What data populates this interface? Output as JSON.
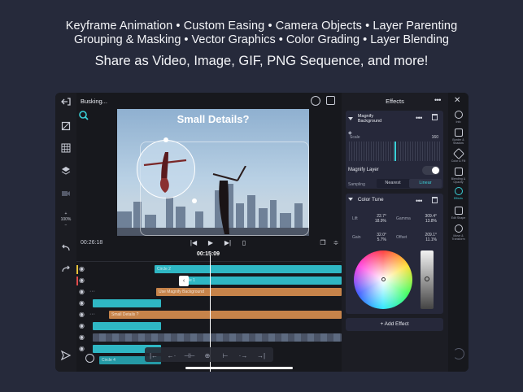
{
  "hero": {
    "line1": "Keyframe Animation • Custom Easing • Camera Objects • Layer Parenting",
    "line2": "Grouping & Masking • Vector Graphics • Color Grading • Layer Blending",
    "line3": "Share as Video, Image, GIF, PNG Sequence, and more!"
  },
  "project": {
    "title": "Busking..."
  },
  "left_toolbar": {
    "zoom": "100%",
    "zoom_plus": "+",
    "zoom_minus": "−"
  },
  "canvas": {
    "headline": "Small Details?"
  },
  "transport": {
    "current_time": "00:26:18",
    "playhead_time": "00:15:09"
  },
  "tracks": [
    {
      "label": "Circle 2",
      "color": "#2fb7c4"
    },
    {
      "label": "Circle 1",
      "color": "#2fb7c4"
    },
    {
      "label": "Use Magnify Background",
      "color": "#c6834a"
    },
    {
      "label": "",
      "color": "#2fb7c4"
    },
    {
      "label": "Small Details ?",
      "color": "#c6834a"
    },
    {
      "label": "",
      "color": "#2fb7c4"
    },
    {
      "label": "",
      "color": "#3b4050"
    },
    {
      "label": "",
      "color": "#2fb7c4"
    },
    {
      "label": "Circle 4",
      "color": "#2fb7c4"
    }
  ],
  "effects_panel": {
    "title": "Effects",
    "magnify": {
      "title_line1": "Magnify",
      "title_line2": "Background",
      "scale_label": "Scale",
      "scale_value": "160",
      "layer_label": "Magnify Layer",
      "sampling_label": "Sampling",
      "sampling_options": [
        "Nearest",
        "Linear"
      ],
      "sampling_selected": "Linear"
    },
    "color_tune": {
      "title": "Color Tune",
      "lift_label": "Lift",
      "lift_value1": "22.7°",
      "lift_value2": "18.9%",
      "gamma_label": "Gamma",
      "gamma_value1": "309.4°",
      "gamma_value2": "13.8%",
      "gain_label": "Gain",
      "gain_value1": "32.0°",
      "gain_value2": "5.7%",
      "offset_label": "Offset",
      "offset_value1": "209.1°",
      "offset_value2": "11.1%"
    },
    "add_effect": "+ Add Effect"
  },
  "right_toolbar": [
    {
      "icon": "more-icon",
      "label": "Info"
    },
    {
      "icon": "border-shadow-icon",
      "label": "Border & Shadow"
    },
    {
      "icon": "color-fill-icon",
      "label": "Color & Fill"
    },
    {
      "icon": "blending-icon",
      "label": "Blending & Opacity"
    },
    {
      "icon": "effects-icon",
      "label": "Effects"
    },
    {
      "icon": "edit-shape-icon",
      "label": "Edit Shape"
    },
    {
      "icon": "move-transform-icon",
      "label": "Move & Transform"
    }
  ],
  "accent": "#3ad1d8"
}
